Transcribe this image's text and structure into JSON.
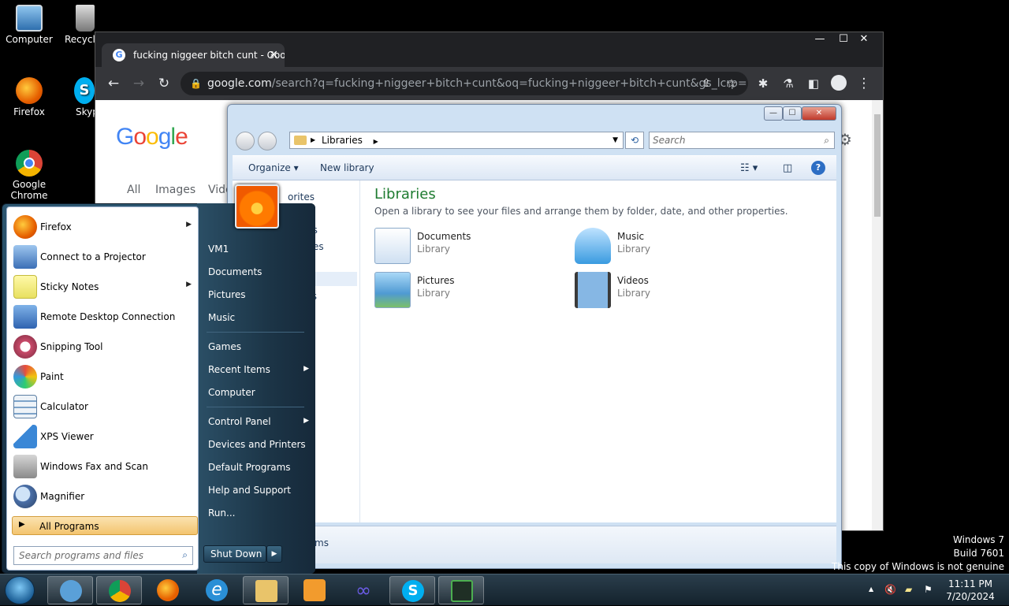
{
  "desktop": {
    "icons": [
      {
        "label": "Computer",
        "icon": "computer-icon"
      },
      {
        "label": "Recycle",
        "icon": "recycle-bin-icon"
      },
      {
        "label": "Firefox",
        "icon": "firefox-icon"
      },
      {
        "label": "Skyp",
        "icon": "skype-icon"
      },
      {
        "label": "Google Chrome",
        "icon": "chrome-icon"
      }
    ]
  },
  "chrome": {
    "tab_title": "fucking niggeer bitch cunt - Goo",
    "tab_close": "✕",
    "window_controls": {
      "minimize": "—",
      "maximize": "☐",
      "close": "✕"
    },
    "url_host": "google.com",
    "url_rest": "/search?q=fucking+niggeer+bitch+cunt&oq=fucking+niggeer+bitch+cunt&gs_lcrp=...",
    "google_tabs": [
      "All",
      "Images",
      "Vide"
    ],
    "logo": [
      "G",
      "o",
      "o",
      "g",
      "l",
      "e"
    ]
  },
  "explorer": {
    "controls": {
      "minimize": "—",
      "maximize": "☐",
      "close": "✕"
    },
    "breadcrumb": "Libraries",
    "search_placeholder": "Search",
    "commands": {
      "organize": "Organize ▾",
      "new_library": "New library"
    },
    "nav": [
      "orites",
      "ds",
      "aces",
      "ts"
    ],
    "title": "Libraries",
    "subtitle": "Open a library to see your files and arrange them by folder, date, and other properties.",
    "libraries": [
      {
        "name": "Documents",
        "type": "Library",
        "icon": "documents-library-icon"
      },
      {
        "name": "Music",
        "type": "Library",
        "icon": "music-library-icon"
      },
      {
        "name": "Pictures",
        "type": "Library",
        "icon": "pictures-library-icon"
      },
      {
        "name": "Videos",
        "type": "Library",
        "icon": "videos-library-icon"
      }
    ],
    "details": "ms"
  },
  "start_menu": {
    "programs": [
      {
        "label": "Firefox",
        "arrow": "▶",
        "color": "#e66000"
      },
      {
        "label": "Connect to a Projector",
        "arrow": "",
        "color": "#3b6fb6"
      },
      {
        "label": "Sticky Notes",
        "arrow": "▶",
        "color": "#e8e060"
      },
      {
        "label": "Remote Desktop Connection",
        "arrow": "",
        "color": "#2f63b0"
      },
      {
        "label": "Snipping Tool",
        "arrow": "",
        "color": "#c94b6a"
      },
      {
        "label": "Paint",
        "arrow": "",
        "color": "#d9a441"
      },
      {
        "label": "Calculator",
        "arrow": "",
        "color": "#7da3c9"
      },
      {
        "label": "XPS Viewer",
        "arrow": "",
        "color": "#3a87d6"
      },
      {
        "label": "Windows Fax and Scan",
        "arrow": "",
        "color": "#8a8a8a"
      },
      {
        "label": "Magnifier",
        "arrow": "",
        "color": "#4a6fa8"
      }
    ],
    "all_programs": "All Programs",
    "all_programs_arrow": "▶",
    "search_placeholder": "Search programs and files",
    "right_links": [
      {
        "label": "VM1",
        "arrow": ""
      },
      {
        "label": "Documents",
        "arrow": ""
      },
      {
        "label": "Pictures",
        "arrow": ""
      },
      {
        "label": "Music",
        "arrow": ""
      },
      {
        "label": "Games",
        "arrow": ""
      },
      {
        "label": "Recent Items",
        "arrow": "▶"
      },
      {
        "label": "Computer",
        "arrow": ""
      },
      {
        "label": "Control Panel",
        "arrow": "▶"
      },
      {
        "label": "Devices and Printers",
        "arrow": ""
      },
      {
        "label": "Default Programs",
        "arrow": ""
      },
      {
        "label": "Help and Support",
        "arrow": ""
      },
      {
        "label": "Run...",
        "arrow": ""
      }
    ],
    "shutdown": "Shut Down",
    "shutdown_arrow": "▶"
  },
  "watermark": {
    "line1": "Windows 7",
    "line2": "Build 7601",
    "line3": "This copy of Windows is not genuine"
  },
  "taskbar": {
    "pinned": [
      {
        "name": "users-icon",
        "color": "#5aa0d8",
        "open": true
      },
      {
        "name": "chrome-icon",
        "color": "#db4437",
        "open": true
      },
      {
        "name": "firefox-icon",
        "color": "#e66000",
        "open": false
      },
      {
        "name": "internet-explorer-icon",
        "color": "#2a8fd6",
        "open": false
      },
      {
        "name": "explorer-folder-icon",
        "color": "#e9c46a",
        "open": true
      },
      {
        "name": "media-player-icon",
        "color": "#f29b2d",
        "open": false
      },
      {
        "name": "infinity-icon",
        "color": "#6c5ce7",
        "open": false
      },
      {
        "name": "skype-icon",
        "color": "#00aff0",
        "open": true
      },
      {
        "name": "task-manager-icon",
        "color": "#4caf50",
        "open": true
      }
    ],
    "tray": {
      "up_arrow": "▲",
      "volume_muted": "🔇",
      "flag": "⚑"
    },
    "time": "11:11 PM",
    "date": "7/20/2024"
  }
}
